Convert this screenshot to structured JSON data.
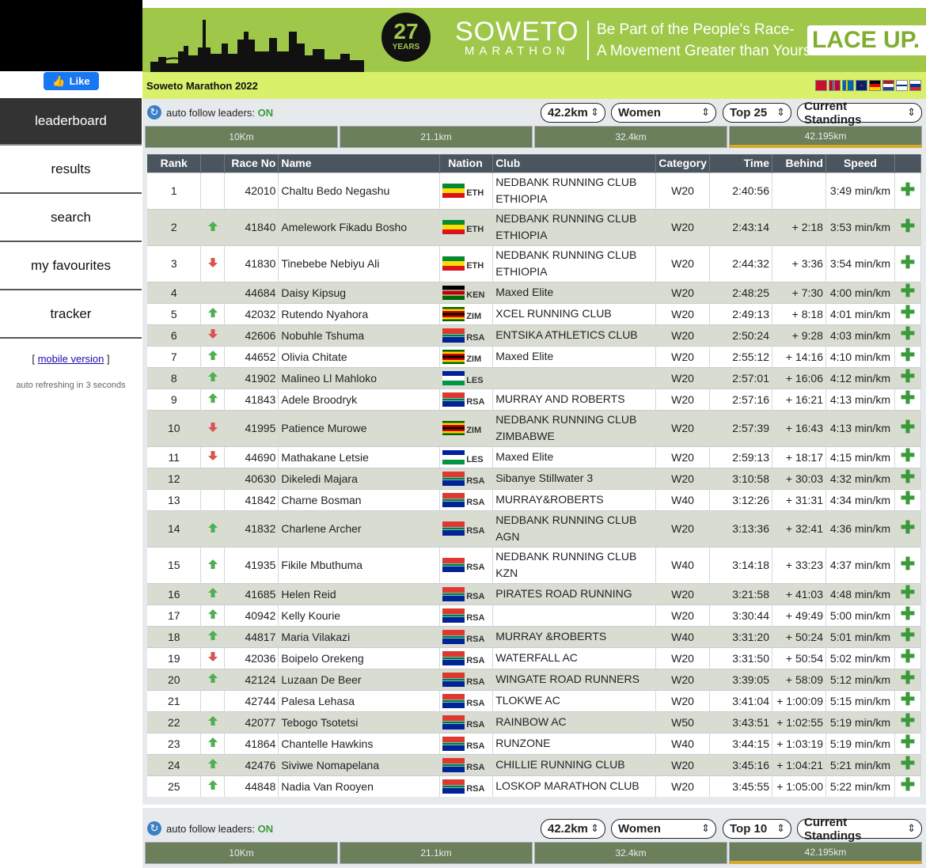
{
  "sidebar": {
    "like_label": "Like",
    "nav": [
      "leaderboard",
      "results",
      "search",
      "my favourites",
      "tracker"
    ],
    "mobile_prefix": "[ ",
    "mobile_link": "mobile version",
    "mobile_suffix": " ]",
    "refresh_text": "auto refreshing in 3 seconds"
  },
  "banner": {
    "badge_number": "27",
    "badge_word": "YEARS",
    "logo_line1": "SOWETO",
    "logo_line2": "MARATHON",
    "tagline1": "Be Part of the People's Race-",
    "tagline2": "A Movement Greater than Yourself",
    "cta": "LACE UP. R"
  },
  "event_title": "Soweto Marathon 2022",
  "colors": {
    "accent_green": "#9fc84a",
    "title_bg": "#d8f06a",
    "up": "#4caf50",
    "down": "#d9534f",
    "tab_bg": "#6a7f5a"
  },
  "controls": {
    "follow_label": "auto follow leaders: ",
    "follow_state": "ON",
    "distance": "42.2km",
    "gender": "Women",
    "top": "Top 25",
    "mode": "Current Standings"
  },
  "controls2": {
    "top": "Top 10"
  },
  "tabs": [
    "10Km",
    "21.1km",
    "32.4km",
    "42.195km"
  ],
  "columns": [
    "Rank",
    "",
    "Race No",
    "Name",
    "Nation",
    "Club",
    "Category",
    "Time",
    "Behind",
    "Speed"
  ],
  "rows": [
    {
      "rank": "1",
      "move": "",
      "no": "42010",
      "name": "Chaltu Bedo Negashu",
      "nation": "ETH",
      "club1": "NEDBANK RUNNING CLUB",
      "club2": "ETHIOPIA",
      "cat": "W20",
      "time": "2:40:56",
      "behind": "",
      "speed": "3:49 min/km"
    },
    {
      "rank": "2",
      "move": "up",
      "no": "41840",
      "name": "Amelework Fikadu Bosho",
      "nation": "ETH",
      "club1": "NEDBANK RUNNING CLUB",
      "club2": "ETHIOPIA",
      "cat": "W20",
      "time": "2:43:14",
      "behind": "+ 2:18",
      "speed": "3:53 min/km"
    },
    {
      "rank": "3",
      "move": "down",
      "no": "41830",
      "name": "Tinebebe Nebiyu Ali",
      "nation": "ETH",
      "club1": "NEDBANK RUNNING CLUB",
      "club2": "ETHIOPIA",
      "cat": "W20",
      "time": "2:44:32",
      "behind": "+ 3:36",
      "speed": "3:54 min/km"
    },
    {
      "rank": "4",
      "move": "",
      "no": "44684",
      "name": "Daisy Kipsug",
      "nation": "KEN",
      "club1": "Maxed Elite",
      "club2": "",
      "cat": "W20",
      "time": "2:48:25",
      "behind": "+ 7:30",
      "speed": "4:00 min/km"
    },
    {
      "rank": "5",
      "move": "up",
      "no": "42032",
      "name": "Rutendo Nyahora",
      "nation": "ZIM",
      "club1": "XCEL RUNNING CLUB",
      "club2": "",
      "cat": "W20",
      "time": "2:49:13",
      "behind": "+ 8:18",
      "speed": "4:01 min/km"
    },
    {
      "rank": "6",
      "move": "down",
      "no": "42606",
      "name": "Nobuhle Tshuma",
      "nation": "RSA",
      "club1": "ENTSIKA ATHLETICS CLUB",
      "club2": "",
      "cat": "W20",
      "time": "2:50:24",
      "behind": "+ 9:28",
      "speed": "4:03 min/km"
    },
    {
      "rank": "7",
      "move": "up",
      "no": "44652",
      "name": "Olivia Chitate",
      "nation": "ZIM",
      "club1": "Maxed Elite",
      "club2": "",
      "cat": "W20",
      "time": "2:55:12",
      "behind": "+ 14:16",
      "speed": "4:10 min/km"
    },
    {
      "rank": "8",
      "move": "up",
      "no": "41902",
      "name": "Malineo Ll Mahloko",
      "nation": "LES",
      "club1": "",
      "club2": "",
      "cat": "W20",
      "time": "2:57:01",
      "behind": "+ 16:06",
      "speed": "4:12 min/km"
    },
    {
      "rank": "9",
      "move": "up",
      "no": "41843",
      "name": "Adele Broodryk",
      "nation": "RSA",
      "club1": "MURRAY AND ROBERTS",
      "club2": "",
      "cat": "W20",
      "time": "2:57:16",
      "behind": "+ 16:21",
      "speed": "4:13 min/km"
    },
    {
      "rank": "10",
      "move": "down",
      "no": "41995",
      "name": "Patience Murowe",
      "nation": "ZIM",
      "club1": "NEDBANK RUNNING CLUB",
      "club2": "ZIMBABWE",
      "cat": "W20",
      "time": "2:57:39",
      "behind": "+ 16:43",
      "speed": "4:13 min/km"
    },
    {
      "rank": "11",
      "move": "down",
      "no": "44690",
      "name": "Mathakane Letsie",
      "nation": "LES",
      "club1": "Maxed Elite",
      "club2": "",
      "cat": "W20",
      "time": "2:59:13",
      "behind": "+ 18:17",
      "speed": "4:15 min/km"
    },
    {
      "rank": "12",
      "move": "",
      "no": "40630",
      "name": "Dikeledi Majara",
      "nation": "RSA",
      "club1": "Sibanye Stillwater 3",
      "club2": "",
      "cat": "W20",
      "time": "3:10:58",
      "behind": "+ 30:03",
      "speed": "4:32 min/km"
    },
    {
      "rank": "13",
      "move": "",
      "no": "41842",
      "name": "Charne Bosman",
      "nation": "RSA",
      "club1": "MURRAY&ROBERTS",
      "club2": "",
      "cat": "W40",
      "time": "3:12:26",
      "behind": "+ 31:31",
      "speed": "4:34 min/km"
    },
    {
      "rank": "14",
      "move": "up",
      "no": "41832",
      "name": "Charlene Archer",
      "nation": "RSA",
      "club1": "NEDBANK RUNNING CLUB",
      "club2": "AGN",
      "cat": "W20",
      "time": "3:13:36",
      "behind": "+ 32:41",
      "speed": "4:36 min/km"
    },
    {
      "rank": "15",
      "move": "up",
      "no": "41935",
      "name": "Fikile Mbuthuma",
      "nation": "RSA",
      "club1": "NEDBANK RUNNING CLUB",
      "club2": "KZN",
      "cat": "W40",
      "time": "3:14:18",
      "behind": "+ 33:23",
      "speed": "4:37 min/km"
    },
    {
      "rank": "16",
      "move": "up",
      "no": "41685",
      "name": "Helen Reid",
      "nation": "RSA",
      "club1": "PIRATES ROAD RUNNING",
      "club2": "",
      "cat": "W20",
      "time": "3:21:58",
      "behind": "+ 41:03",
      "speed": "4:48 min/km"
    },
    {
      "rank": "17",
      "move": "up",
      "no": "40942",
      "name": "Kelly Kourie",
      "nation": "RSA",
      "club1": "",
      "club2": "",
      "cat": "W20",
      "time": "3:30:44",
      "behind": "+ 49:49",
      "speed": "5:00 min/km"
    },
    {
      "rank": "18",
      "move": "up",
      "no": "44817",
      "name": "Maria Vilakazi",
      "nation": "RSA",
      "club1": "MURRAY &ROBERTS",
      "club2": "",
      "cat": "W40",
      "time": "3:31:20",
      "behind": "+ 50:24",
      "speed": "5:01 min/km"
    },
    {
      "rank": "19",
      "move": "down",
      "no": "42036",
      "name": "Boipelo Orekeng",
      "nation": "RSA",
      "club1": "WATERFALL AC",
      "club2": "",
      "cat": "W20",
      "time": "3:31:50",
      "behind": "+ 50:54",
      "speed": "5:02 min/km"
    },
    {
      "rank": "20",
      "move": "up",
      "no": "42124",
      "name": "Luzaan De Beer",
      "nation": "RSA",
      "club1": "WINGATE ROAD RUNNERS",
      "club2": "",
      "cat": "W20",
      "time": "3:39:05",
      "behind": "+ 58:09",
      "speed": "5:12 min/km"
    },
    {
      "rank": "21",
      "move": "",
      "no": "42744",
      "name": "Palesa Lehasa",
      "nation": "RSA",
      "club1": "TLOKWE AC",
      "club2": "",
      "cat": "W20",
      "time": "3:41:04",
      "behind": "+ 1:00:09",
      "speed": "5:15 min/km"
    },
    {
      "rank": "22",
      "move": "up",
      "no": "42077",
      "name": "Tebogo Tsotetsi",
      "nation": "RSA",
      "club1": "RAINBOW AC",
      "club2": "",
      "cat": "W50",
      "time": "3:43:51",
      "behind": "+ 1:02:55",
      "speed": "5:19 min/km"
    },
    {
      "rank": "23",
      "move": "up",
      "no": "41864",
      "name": "Chantelle Hawkins",
      "nation": "RSA",
      "club1": "RUNZONE",
      "club2": "",
      "cat": "W40",
      "time": "3:44:15",
      "behind": "+ 1:03:19",
      "speed": "5:19 min/km"
    },
    {
      "rank": "24",
      "move": "up",
      "no": "42476",
      "name": "Siviwe Nomapelana",
      "nation": "RSA",
      "club1": "CHILLIE RUNNING CLUB",
      "club2": "",
      "cat": "W20",
      "time": "3:45:16",
      "behind": "+ 1:04:21",
      "speed": "5:21 min/km"
    },
    {
      "rank": "25",
      "move": "up",
      "no": "44848",
      "name": "Nadia Van Rooyen",
      "nation": "RSA",
      "club1": "LOSKOP MARATHON CLUB",
      "club2": "",
      "cat": "W20",
      "time": "3:45:55",
      "behind": "+ 1:05:00",
      "speed": "5:22 min/km"
    }
  ]
}
